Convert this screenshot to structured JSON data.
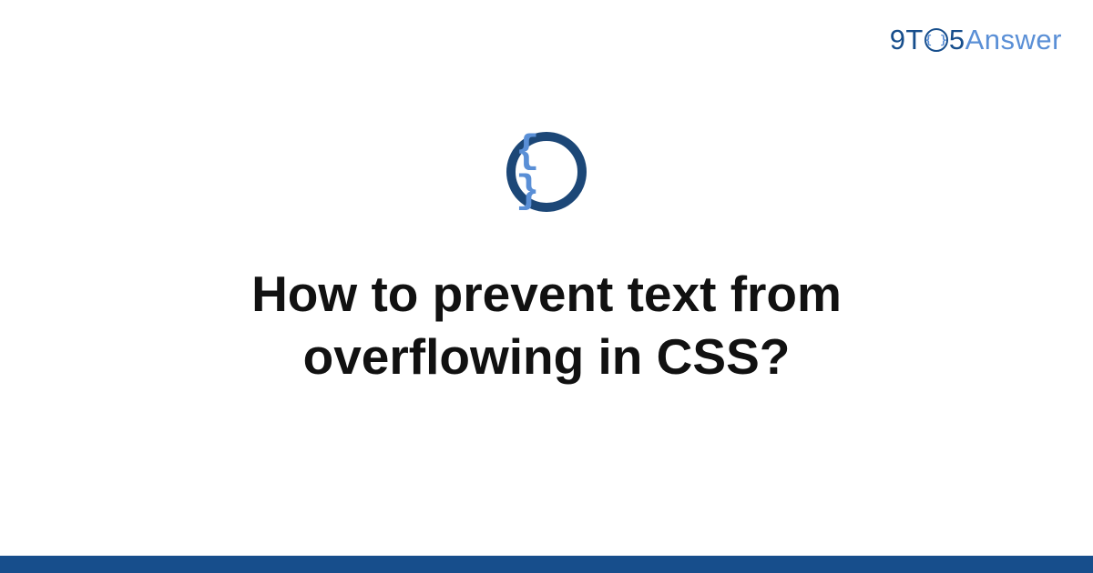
{
  "logo": {
    "part1": "9T",
    "braces": "{ }",
    "part2": "5",
    "part3": "Answer"
  },
  "badge": {
    "braces": "{ }"
  },
  "title": "How to prevent text from overflowing in CSS?",
  "colors": {
    "primary": "#174e8c",
    "accent": "#5a8fd6",
    "text": "#111111"
  }
}
